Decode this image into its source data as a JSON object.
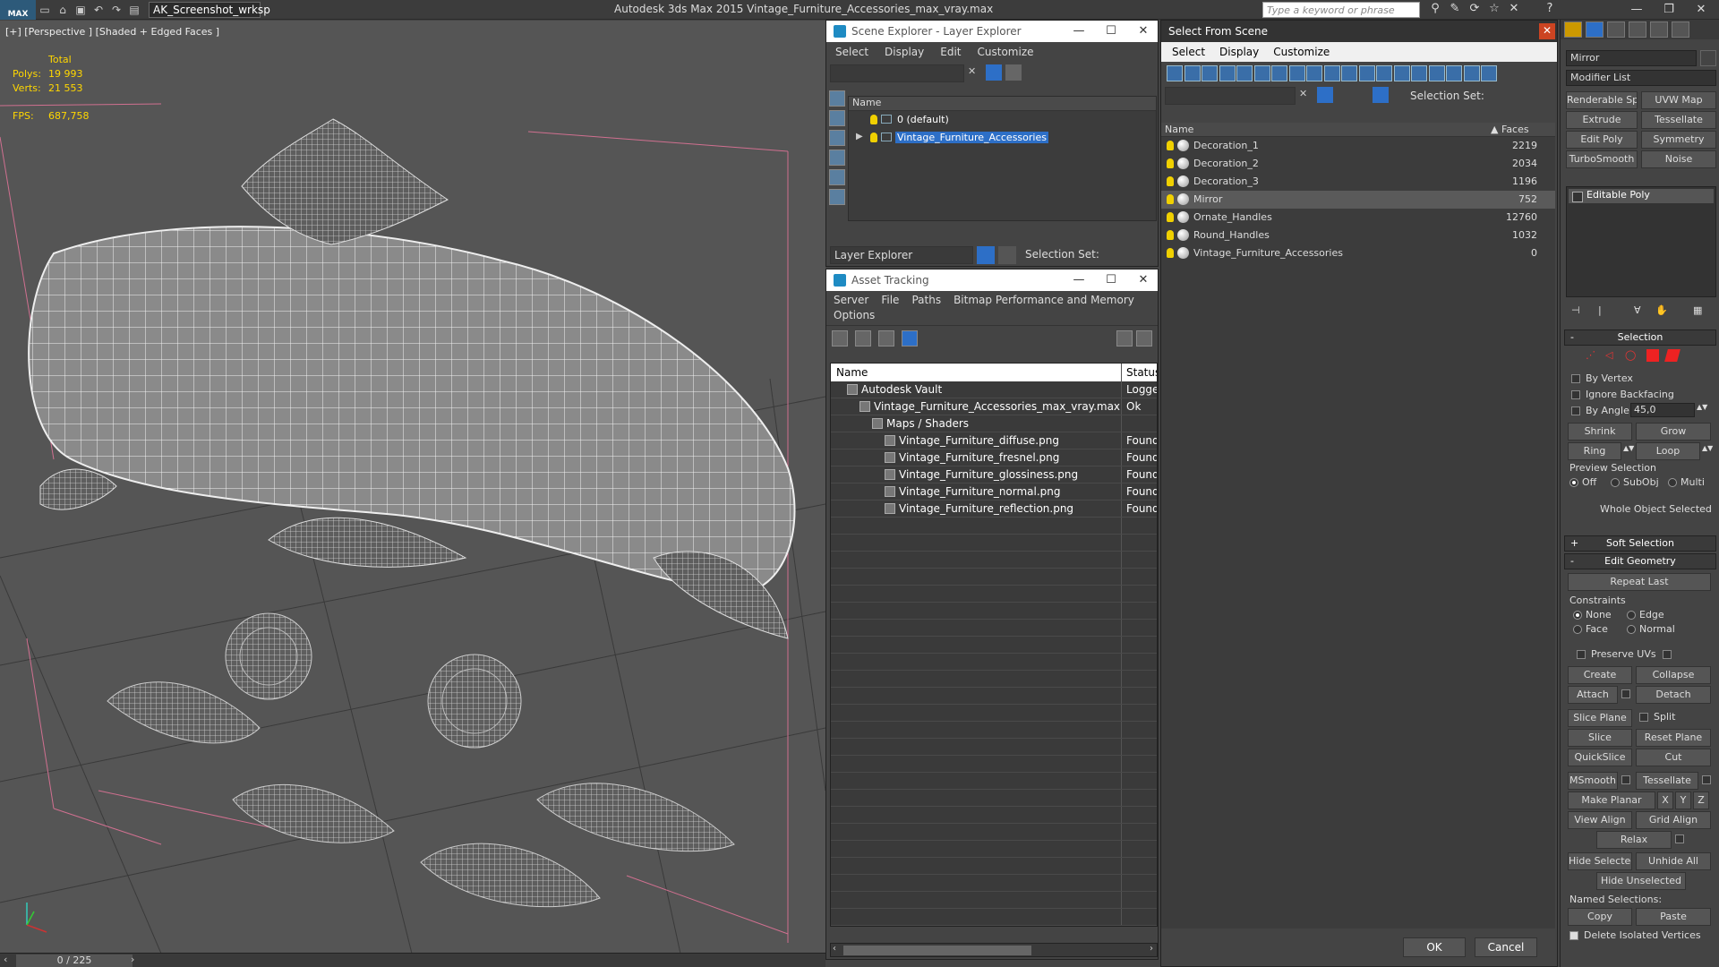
{
  "titlebar": {
    "logo": "MAX",
    "workspace": "AK_Screenshot_wrksp",
    "app_title": "Autodesk 3ds Max  2015    Vintage_Furniture_Accessories_max_vray.max",
    "search_placeholder": "Type a keyword or phrase"
  },
  "viewport": {
    "label": "[+] [Perspective ] [Shaded + Edged Faces ]",
    "stats_header": "Total",
    "polys_label": "Polys:",
    "polys_value": "19 993",
    "verts_label": "Verts:",
    "verts_value": "21 553",
    "fps_label": "FPS:",
    "fps_value": "687,758",
    "time_slider": "0 / 225"
  },
  "scene_explorer": {
    "title": "Scene Explorer - Layer Explorer",
    "menu": [
      "Select",
      "Display",
      "Edit",
      "Customize"
    ],
    "column": "Name",
    "layers": [
      {
        "name": "0 (default)",
        "selected": false
      },
      {
        "name": "Vintage_Furniture_Accessories",
        "selected": true
      }
    ],
    "mode_dropdown": "Layer Explorer",
    "selection_set_label": "Selection Set:"
  },
  "asset_tracking": {
    "title": "Asset Tracking",
    "menu": [
      "Server",
      "File",
      "Paths",
      "Bitmap Performance and Memory"
    ],
    "menu2": "Options",
    "col_name": "Name",
    "col_status": "Status",
    "rows": [
      {
        "name": "Autodesk Vault",
        "status": "Logged",
        "indent": 1
      },
      {
        "name": "Vintage_Furniture_Accessories_max_vray.max",
        "status": "Ok",
        "indent": 2
      },
      {
        "name": "Maps / Shaders",
        "status": "",
        "indent": 3
      },
      {
        "name": "Vintage_Furniture_diffuse.png",
        "status": "Found",
        "indent": 4
      },
      {
        "name": "Vintage_Furniture_fresnel.png",
        "status": "Found",
        "indent": 4
      },
      {
        "name": "Vintage_Furniture_glossiness.png",
        "status": "Found",
        "indent": 4
      },
      {
        "name": "Vintage_Furniture_normal.png",
        "status": "Found",
        "indent": 4
      },
      {
        "name": "Vintage_Furniture_reflection.png",
        "status": "Found",
        "indent": 4
      }
    ]
  },
  "select_scene": {
    "title": "Select From Scene",
    "menu": [
      "Select",
      "Display",
      "Customize"
    ],
    "selection_set_label": "Selection Set:",
    "col_name": "Name",
    "col_faces": "Faces",
    "objects": [
      {
        "name": "Decoration_1",
        "faces": "2219",
        "selected": false
      },
      {
        "name": "Decoration_2",
        "faces": "2034",
        "selected": false
      },
      {
        "name": "Decoration_3",
        "faces": "1196",
        "selected": false
      },
      {
        "name": "Mirror",
        "faces": "752",
        "selected": true
      },
      {
        "name": "Ornate_Handles",
        "faces": "12760",
        "selected": false
      },
      {
        "name": "Round_Handles",
        "faces": "1032",
        "selected": false
      },
      {
        "name": "Vintage_Furniture_Accessories",
        "faces": "0",
        "selected": false
      }
    ],
    "ok": "OK",
    "cancel": "Cancel"
  },
  "command_panel": {
    "object_name": "Mirror",
    "modifier_list": "Modifier List",
    "mod_buttons": [
      "Renderable Spline",
      "UVW Map",
      "Extrude",
      "Tessellate",
      "Edit Poly",
      "Symmetry",
      "TurboSmooth",
      "Noise"
    ],
    "stack_item": "Editable Poly",
    "selection_header": "Selection",
    "by_vertex": "By Vertex",
    "ignore_backfacing": "Ignore Backfacing",
    "by_angle": "By Angle:",
    "angle_value": "45,0",
    "shrink": "Shrink",
    "grow": "Grow",
    "ring": "Ring",
    "loop": "Loop",
    "preview_selection": "Preview Selection",
    "preview_off": "Off",
    "preview_subobj": "SubObj",
    "preview_multi": "Multi",
    "whole_object": "Whole Object Selected",
    "soft_selection": "Soft Selection",
    "edit_geometry": "Edit Geometry",
    "repeat_last": "Repeat Last",
    "constraints": "Constraints",
    "c_none": "None",
    "c_edge": "Edge",
    "c_face": "Face",
    "c_normal": "Normal",
    "preserve_uvs": "Preserve UVs",
    "create": "Create",
    "collapse": "Collapse",
    "attach": "Attach",
    "detach": "Detach",
    "slice_plane": "Slice Plane",
    "split": "Split",
    "slice": "Slice",
    "reset_plane": "Reset Plane",
    "quickslice": "QuickSlice",
    "cut": "Cut",
    "msmooth": "MSmooth",
    "tessellate": "Tessellate",
    "make_planar": "Make Planar",
    "x": "X",
    "y": "Y",
    "z": "Z",
    "view_align": "View Align",
    "grid_align": "Grid Align",
    "relax": "Relax",
    "hide_selected": "Hide Selected",
    "unhide_all": "Unhide All",
    "hide_unselected": "Hide Unselected",
    "named_selections": "Named Selections:",
    "copy": "Copy",
    "paste": "Paste",
    "delete_isolated": "Delete Isolated Vertices"
  },
  "colors": {
    "accent": "#2d6fc7",
    "stats": "#ffd700",
    "bulb": "#f0d000"
  }
}
